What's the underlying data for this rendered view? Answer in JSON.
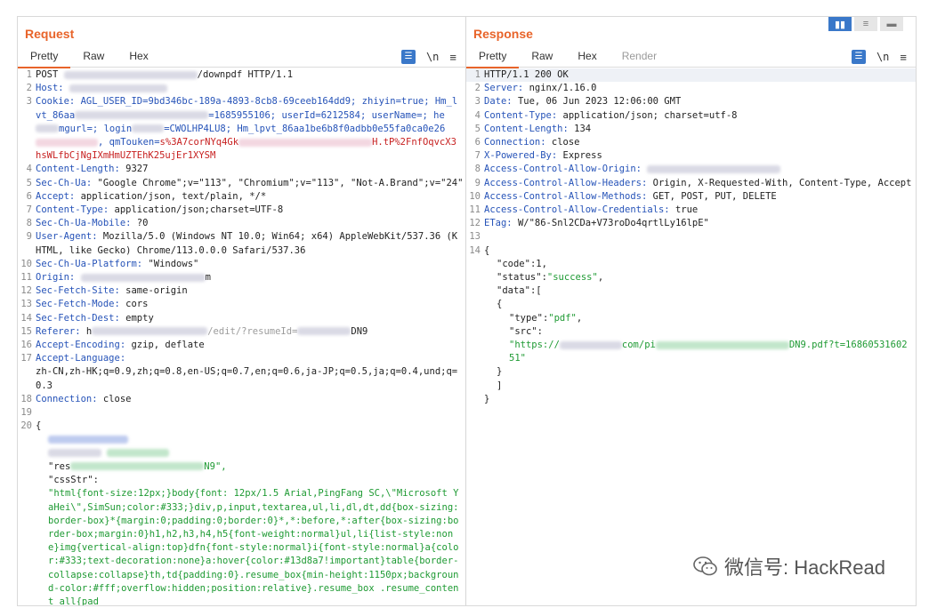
{
  "layout_toggle": {
    "options": [
      "▮▮",
      "≡",
      "▬"
    ]
  },
  "request": {
    "title": "Request",
    "tabs": [
      "Pretty",
      "Raw",
      "Hex"
    ],
    "toolbar": {
      "ln_label": "\\n",
      "menu_label": "≡"
    },
    "lines": {
      "l1": {
        "n": "1",
        "method": "POST",
        "path_tail": "/downpdf HTTP/1.1"
      },
      "l2": {
        "n": "2",
        "key": "Host:"
      },
      "l3": {
        "n": "3",
        "key": "Cookie:",
        "p1": "AGL_USER_ID=9bd346bc-189a-4893-8cb8-69ceeb164dd9; zhiyin=true;",
        "p2": "Hm_lvt_86aa",
        "p3": "=1685955106; userId=6212584; userName",
        "p4": "=; he",
        "p5": "mgurl=; login",
        "p6": "=CWOLHP4LU8;",
        "p7": "Hm_lpvt_86aa1be6b8f0adbb0e55fa0ca0e26",
        "p8": ", qmTouken=",
        "p9": "s%3A7corNYq4Gk",
        "p10": "H.tP%2FnfOqvcX3hsWLfbCjNgIXmHmUZTEhK25ujE",
        "p11": "r1XYSM"
      },
      "l4": {
        "n": "4",
        "key": "Content-Length:",
        "val": "9327"
      },
      "l5": {
        "n": "5",
        "key": "Sec-Ch-Ua:",
        "val": "\"Google Chrome\";v=\"113\", \"Chromium\";v=\"113\", \"Not-A.Brand\";v=\"24\""
      },
      "l6": {
        "n": "6",
        "key": "Accept:",
        "val": "application/json, text/plain, */*"
      },
      "l7": {
        "n": "7",
        "key": "Content-Type:",
        "val": "application/json;charset=UTF-8"
      },
      "l8": {
        "n": "8",
        "key": "Sec-Ch-Ua-Mobile:",
        "val": "?0"
      },
      "l9": {
        "n": "9",
        "key": "User-Agent:",
        "val": "Mozilla/5.0 (Windows NT 10.0; Win64; x64) AppleWebKit/537.36 (KHTML, like Gecko) Chrome/113.0.0.0 Safari/537.36"
      },
      "l10": {
        "n": "10",
        "key": "Sec-Ch-Ua-Platform:",
        "val": "\"Windows\""
      },
      "l11": {
        "n": "11",
        "key": "Origin:",
        "val": "m"
      },
      "l12": {
        "n": "12",
        "key": "Sec-Fetch-Site:",
        "val": "same-origin"
      },
      "l13": {
        "n": "13",
        "key": "Sec-Fetch-Mode:",
        "val": "cors"
      },
      "l14": {
        "n": "14",
        "key": "Sec-Fetch-Dest:",
        "val": "empty"
      },
      "l15": {
        "n": "15",
        "key": "Referer:",
        "val_a": "h",
        "val_b": "/edit/?resumeId=",
        "val_c": "DN9"
      },
      "l16": {
        "n": "16",
        "key": "Accept-Encoding:",
        "val": "gzip, deflate"
      },
      "l17": {
        "n": "17",
        "key": "Accept-Language:",
        "val": "zh-CN,zh-HK;q=0.9,zh;q=0.8,en-US;q=0.7,en;q=0.6,ja-JP;q=0.5,ja;q=0.4,und;q=0.3"
      },
      "l18": {
        "n": "18",
        "key": "Connection:",
        "val": "close"
      },
      "l19": {
        "n": "19"
      },
      "l20": {
        "n": "20",
        "brace": "{"
      },
      "b1": {
        "text": "\"res",
        "text2": "N9\","
      },
      "b2": {
        "text": "\"cssStr\":"
      },
      "b3": {
        "text": "\"html{font-size:12px;}body{font: 12px/1.5 Arial,PingFang SC,\\\"Microsoft YaHei\\\",SimSun;color:#333;}div,p,input,textarea,ul,li,dl,dt,dd{box-sizing:border-box}*{margin:0;padding:0;border:0}*,*:before,*:after{box-sizing:border-box;margin:0}h1,h2,h3,h4,h5{font-weight:normal}ul,li{list-style:none}img{vertical-align:top}dfn{font-style:normal}i{font-style:normal}a{color:#333;text-decoration:none}a:hover{color:#13d8a7!important}table{border-collapse:collapse}th,td{padding:0}.resume_box{min-height:1150px;background-color:#fff;overflow:hidden;position:relative}.resume_box .resume_content_all{pad"
      }
    }
  },
  "response": {
    "title": "Response",
    "tabs": [
      "Pretty",
      "Raw",
      "Hex",
      "Render"
    ],
    "toolbar": {
      "ln_label": "\\n",
      "menu_label": "≡"
    },
    "lines": {
      "l1": {
        "n": "1",
        "val": "HTTP/1.1 200 OK"
      },
      "l2": {
        "n": "2",
        "key": "Server:",
        "val": "nginx/1.16.0"
      },
      "l3": {
        "n": "3",
        "key": "Date:",
        "val": "Tue, 06 Jun 2023 12:06:00 GMT"
      },
      "l4": {
        "n": "4",
        "key": "Content-Type:",
        "val": "application/json; charset=utf-8"
      },
      "l5": {
        "n": "5",
        "key": "Content-Length:",
        "val": "134"
      },
      "l6": {
        "n": "6",
        "key": "Connection:",
        "val": "close"
      },
      "l7": {
        "n": "7",
        "key": "X-Powered-By:",
        "val": "Express"
      },
      "l8": {
        "n": "8",
        "key": "Access-Control-Allow-Origin:"
      },
      "l9": {
        "n": "9",
        "key": "Access-Control-Allow-Headers:",
        "val": "Origin, X-Requested-With, Content-Type, Accept"
      },
      "l10": {
        "n": "10",
        "key": "Access-Control-Allow-Methods:",
        "val": "GET, POST, PUT, DELETE"
      },
      "l11": {
        "n": "11",
        "key": "Access-Control-Allow-Credentials:",
        "val": "true"
      },
      "l12": {
        "n": "12",
        "key": "ETag:",
        "val": "W/\"86-Snl2CDa+V73roDo4qrtlLy16lpE\""
      },
      "l13": {
        "n": "13"
      },
      "l14": {
        "n": "14",
        "brace": "{"
      },
      "j1": {
        "key": "\"code\"",
        "val": ":1,"
      },
      "j2": {
        "key": "\"status\"",
        "colon": ":",
        "val": "\"success\"",
        "end": ","
      },
      "j3": {
        "key": "\"data\"",
        "val": ":["
      },
      "j4": {
        "open": "{"
      },
      "j5": {
        "key": "\"type\"",
        "colon": ":",
        "val": "\"pdf\"",
        "end": ","
      },
      "j6": {
        "key": "\"src\"",
        "colon": ":"
      },
      "j7": {
        "a": "\"https://",
        "b": "com/pi",
        "c": "DN9.pdf?t=1686053160251\""
      },
      "j8": {
        "close": "}"
      },
      "j9": {
        "close": "]"
      },
      "j10": {
        "close": "}"
      }
    }
  },
  "watermark": {
    "text": "微信号: HackRead"
  }
}
